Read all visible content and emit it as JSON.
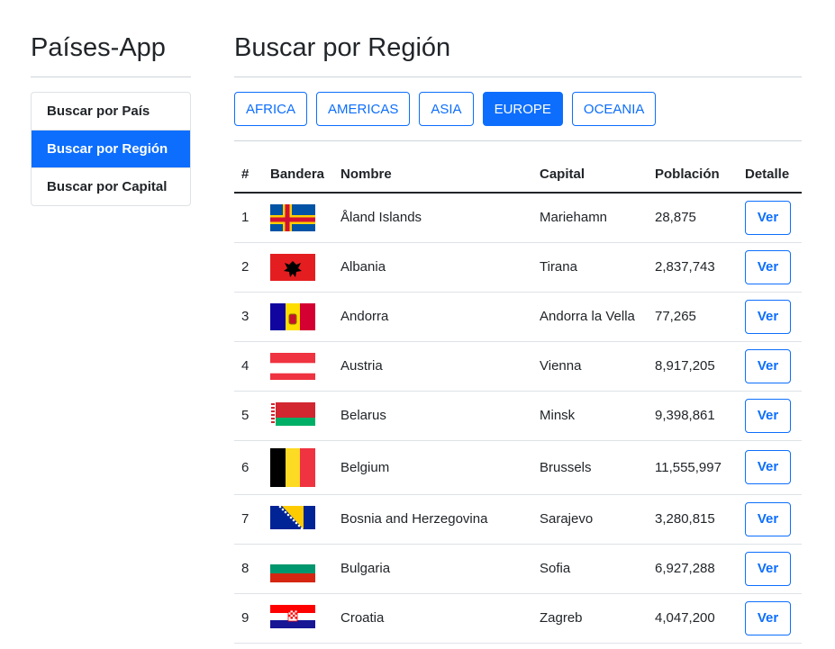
{
  "sidebar": {
    "title": "Países-App",
    "items": [
      {
        "label": "Buscar por País"
      },
      {
        "label": "Buscar por Región"
      },
      {
        "label": "Buscar por Capital"
      }
    ]
  },
  "main": {
    "title": "Buscar por Región",
    "regions": [
      "AFRICA",
      "AMERICAS",
      "ASIA",
      "EUROPE",
      "OCEANIA"
    ],
    "selected_region": "EUROPE"
  },
  "table": {
    "headers": [
      "#",
      "Bandera",
      "Nombre",
      "Capital",
      "Población",
      "Detalle"
    ],
    "rows": [
      {
        "n": "1",
        "flag": "aland-flag",
        "name": "Åland Islands",
        "capital": "Mariehamn",
        "population": "28,875",
        "action": "Ver"
      },
      {
        "n": "2",
        "flag": "albania-flag",
        "name": "Albania",
        "capital": "Tirana",
        "population": "2,837,743",
        "action": "Ver"
      },
      {
        "n": "3",
        "flag": "andorra-flag",
        "name": "Andorra",
        "capital": "Andorra la Vella",
        "population": "77,265",
        "action": "Ver"
      },
      {
        "n": "4",
        "flag": "austria-flag",
        "name": "Austria",
        "capital": "Vienna",
        "population": "8,917,205",
        "action": "Ver"
      },
      {
        "n": "5",
        "flag": "belarus-flag",
        "name": "Belarus",
        "capital": "Minsk",
        "population": "9,398,861",
        "action": "Ver"
      },
      {
        "n": "6",
        "flag": "belgium-flag",
        "name": "Belgium",
        "capital": "Brussels",
        "population": "11,555,997",
        "action": "Ver"
      },
      {
        "n": "7",
        "flag": "bosnia-flag",
        "name": "Bosnia and Herzegovina",
        "capital": "Sarajevo",
        "population": "3,280,815",
        "action": "Ver"
      },
      {
        "n": "8",
        "flag": "bulgaria-flag",
        "name": "Bulgaria",
        "capital": "Sofia",
        "population": "6,927,288",
        "action": "Ver"
      },
      {
        "n": "9",
        "flag": "croatia-flag",
        "name": "Croatia",
        "capital": "Zagreb",
        "population": "4,047,200",
        "action": "Ver"
      }
    ]
  },
  "colors": {
    "primary": "#0d6efd",
    "text": "#212529",
    "border": "#dee2e6"
  }
}
